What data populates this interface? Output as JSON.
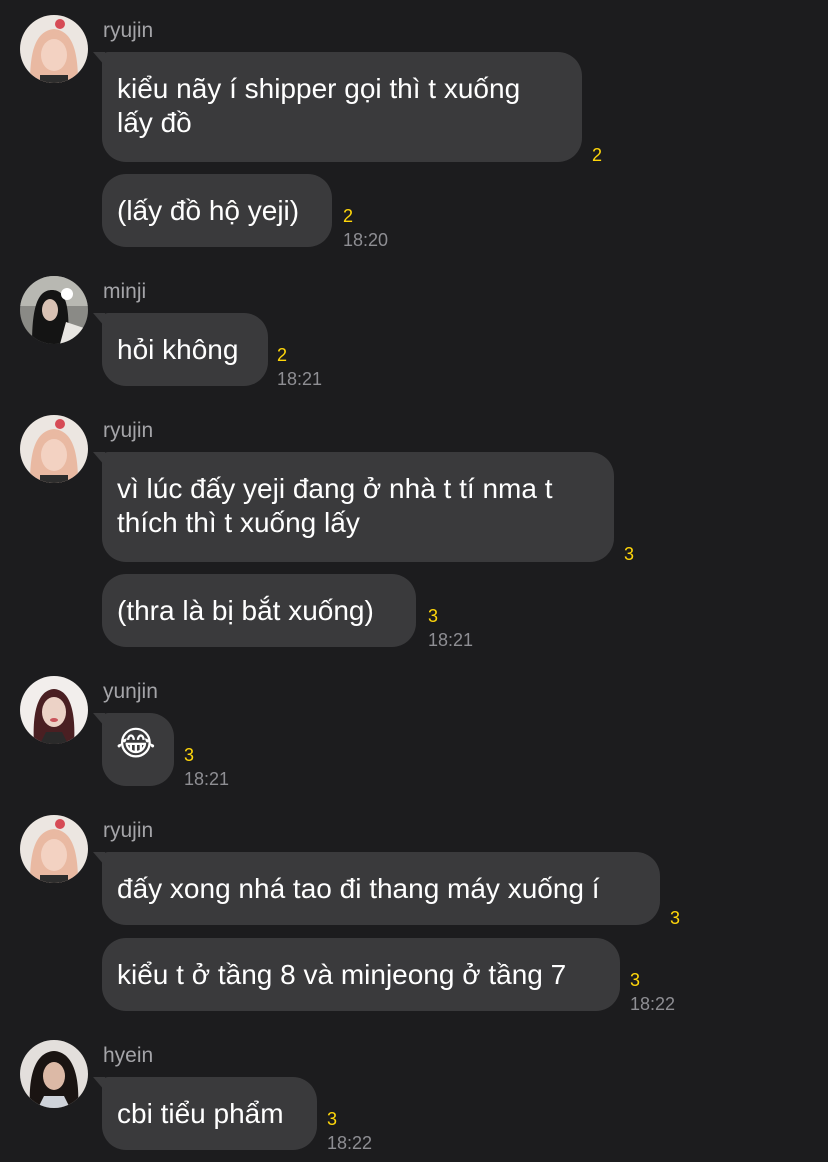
{
  "messages": [
    {
      "sender": "ryujin",
      "text": "kiểu nãy í shipper gọi thì t xuống\nlấy đồ",
      "read": "2"
    },
    {
      "text": "(lấy đồ hộ yeji)",
      "read": "2",
      "time": "18:20"
    },
    {
      "sender": "minji",
      "text": "hỏi không",
      "read": "2",
      "time": "18:21"
    },
    {
      "sender": "ryujin",
      "text": "vì lúc đấy yeji đang ở nhà t tí nma t\nthích thì t xuống lấy",
      "read": "3"
    },
    {
      "text": "(thra là bị bắt xuống)",
      "read": "3",
      "time": "18:21"
    },
    {
      "sender": "yunjin",
      "text": "😂",
      "read": "3",
      "time": "18:21"
    },
    {
      "sender": "ryujin",
      "text": "đấy xong nhá tao đi thang máy xuống í",
      "read": "3"
    },
    {
      "text": "kiểu t ở tầng 8 và minjeong ở tầng 7",
      "read": "3",
      "time": "18:22"
    },
    {
      "sender": "hyein",
      "text": "cbi tiểu phẩm",
      "read": "3",
      "time": "18:22"
    }
  ],
  "colors": {
    "background": "#1c1c1e",
    "bubble": "#3a3a3c",
    "read_count": "#ffd60a",
    "time": "#8e8e93",
    "sender": "#a4a4a8"
  }
}
